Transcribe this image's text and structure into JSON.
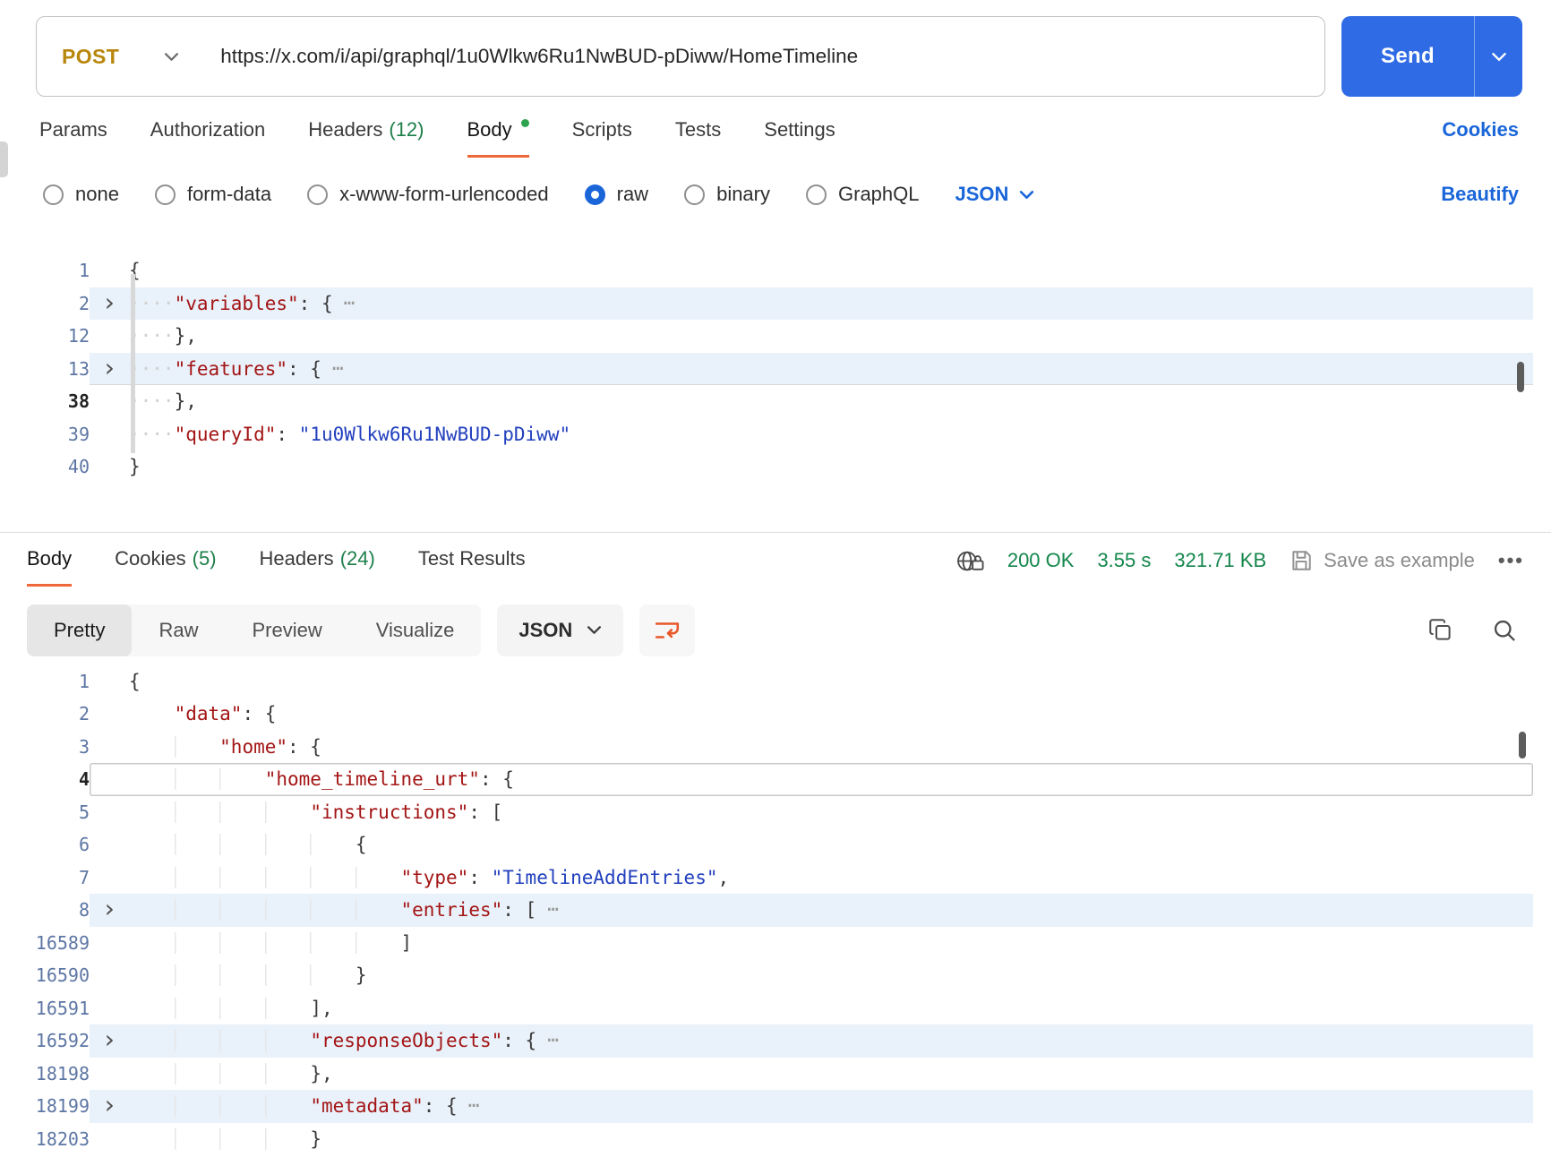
{
  "colors": {
    "accent": "#ef6839",
    "link": "#1a66d9",
    "send": "#2e6be4",
    "green": "#1d7f4a",
    "status-green": "#13864b",
    "method": "#b8860b",
    "hl": "#e9f1fa",
    "key": "#a31515",
    "str": "#2240bd"
  },
  "request": {
    "method": "POST",
    "url": "https://x.com/i/api/graphql/1u0Wlkw6Ru1NwBUD-pDiww/HomeTimeline",
    "send_label": "Send",
    "cookies_link": "Cookies",
    "beautify_link": "Beautify",
    "format": "JSON",
    "tabs": [
      {
        "label": "Params"
      },
      {
        "label": "Authorization"
      },
      {
        "label": "Headers",
        "count": "(12)"
      },
      {
        "label": "Body",
        "active": true,
        "dot": true
      },
      {
        "label": "Scripts"
      },
      {
        "label": "Tests"
      },
      {
        "label": "Settings"
      }
    ],
    "body_types": [
      {
        "label": "none"
      },
      {
        "label": "form-data"
      },
      {
        "label": "x-www-form-urlencoded"
      },
      {
        "label": "raw",
        "selected": true
      },
      {
        "label": "binary"
      },
      {
        "label": "GraphQL"
      }
    ]
  },
  "request_editor": {
    "show_whitespace": true,
    "lines": [
      {
        "n": "1",
        "toks": [
          [
            "p",
            "{"
          ]
        ]
      },
      {
        "n": "2",
        "chev": true,
        "hl": true,
        "ind": 4,
        "toks": [
          [
            "k",
            "\"variables\""
          ],
          [
            "p",
            ": {"
          ],
          [
            "e",
            "…"
          ]
        ]
      },
      {
        "n": "12",
        "ind": 4,
        "toks": [
          [
            "p",
            "},"
          ]
        ]
      },
      {
        "n": "13",
        "chev": true,
        "hl": true,
        "bb": true,
        "ind": 4,
        "toks": [
          [
            "k",
            "\"features\""
          ],
          [
            "p",
            ": {"
          ],
          [
            "e",
            "…"
          ]
        ]
      },
      {
        "n": "38",
        "cur": true,
        "ind": 4,
        "toks": [
          [
            "p",
            "},"
          ]
        ]
      },
      {
        "n": "39",
        "ind": 4,
        "toks": [
          [
            "k",
            "\"queryId\""
          ],
          [
            "p",
            ": "
          ],
          [
            "s",
            "\"1u0Wlkw6Ru1NwBUD-pDiww\""
          ]
        ]
      },
      {
        "n": "40",
        "toks": [
          [
            "p",
            "}"
          ]
        ]
      }
    ]
  },
  "response": {
    "tabs": [
      {
        "label": "Body",
        "active": true
      },
      {
        "label": "Cookies",
        "count": "(5)"
      },
      {
        "label": "Headers",
        "count": "(24)"
      },
      {
        "label": "Test Results"
      }
    ],
    "status_code": "200 OK",
    "time": "3.55 s",
    "size": "321.71 KB",
    "save_as_example": "Save as example",
    "more_options": "•••",
    "format": "JSON",
    "view_tabs": [
      {
        "label": "Pretty",
        "active": true
      },
      {
        "label": "Raw"
      },
      {
        "label": "Preview"
      },
      {
        "label": "Visualize"
      }
    ]
  },
  "response_editor": {
    "indent_guides": true,
    "lines": [
      {
        "n": "1",
        "toks": [
          [
            "p",
            "{"
          ]
        ]
      },
      {
        "n": "2",
        "ind": 4,
        "toks": [
          [
            "k",
            "\"data\""
          ],
          [
            "p",
            ": {"
          ]
        ]
      },
      {
        "n": "3",
        "ind": 8,
        "toks": [
          [
            "k",
            "\"home\""
          ],
          [
            "p",
            ": {"
          ]
        ]
      },
      {
        "n": "4",
        "cur": true,
        "box": true,
        "ind": 12,
        "toks": [
          [
            "k",
            "\"home_timeline_urt\""
          ],
          [
            "p",
            ": {"
          ]
        ]
      },
      {
        "n": "5",
        "ind": 16,
        "toks": [
          [
            "k",
            "\"instructions\""
          ],
          [
            "p",
            ": ["
          ]
        ]
      },
      {
        "n": "6",
        "ind": 20,
        "toks": [
          [
            "p",
            "{"
          ]
        ]
      },
      {
        "n": "7",
        "ind": 24,
        "toks": [
          [
            "k",
            "\"type\""
          ],
          [
            "p",
            ": "
          ],
          [
            "s",
            "\"TimelineAddEntries\""
          ],
          [
            "p",
            ","
          ]
        ]
      },
      {
        "n": "8",
        "chev": true,
        "hl": true,
        "ind": 24,
        "toks": [
          [
            "k",
            "\"entries\""
          ],
          [
            "p",
            ": ["
          ],
          [
            "e",
            "…"
          ]
        ]
      },
      {
        "n": "16589",
        "ind": 24,
        "toks": [
          [
            "p",
            "]"
          ]
        ]
      },
      {
        "n": "16590",
        "ind": 20,
        "toks": [
          [
            "p",
            "}"
          ]
        ]
      },
      {
        "n": "16591",
        "ind": 16,
        "toks": [
          [
            "p",
            "],"
          ]
        ]
      },
      {
        "n": "16592",
        "chev": true,
        "hl": true,
        "ind": 16,
        "toks": [
          [
            "k",
            "\"responseObjects\""
          ],
          [
            "p",
            ": {"
          ],
          [
            "e",
            "…"
          ]
        ]
      },
      {
        "n": "18198",
        "ind": 16,
        "toks": [
          [
            "p",
            "},"
          ]
        ]
      },
      {
        "n": "18199",
        "chev": true,
        "hl": true,
        "ind": 16,
        "toks": [
          [
            "k",
            "\"metadata\""
          ],
          [
            "p",
            ": {"
          ],
          [
            "e",
            "…"
          ]
        ]
      },
      {
        "n": "18203",
        "ind": 16,
        "toks": [
          [
            "p",
            "}"
          ]
        ]
      }
    ]
  }
}
